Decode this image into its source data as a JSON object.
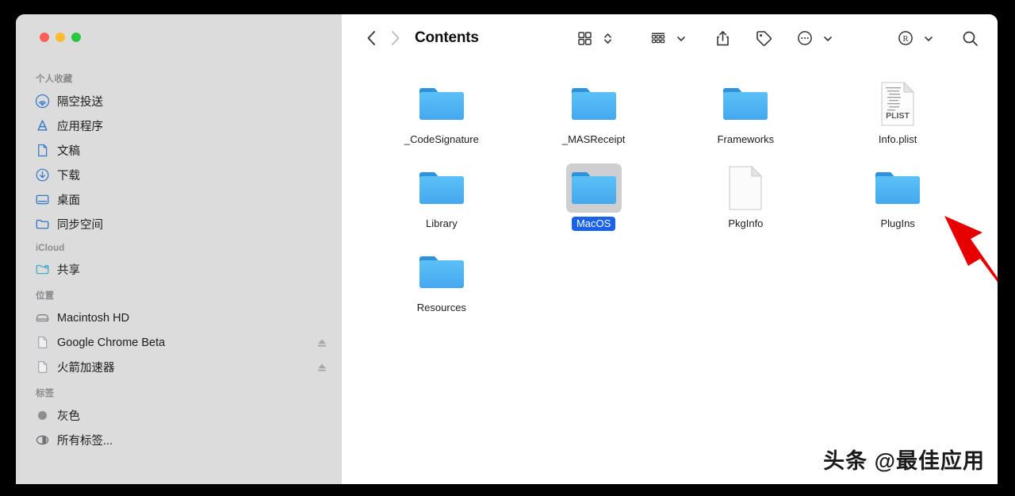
{
  "window": {
    "traffic_lights": [
      {
        "name": "close",
        "color": "#ff5f57"
      },
      {
        "name": "minimize",
        "color": "#febc2e"
      },
      {
        "name": "zoom",
        "color": "#28c840"
      }
    ]
  },
  "toolbar": {
    "back_icon": "chevron-left-icon",
    "forward_icon": "chevron-right-icon",
    "title": "Contents",
    "view_icon": "grid-view-icon",
    "view_chevron_icon": "chevron-up-down-icon",
    "group_icon": "group-by-icon",
    "group_chevron_icon": "chevron-down-icon",
    "share_icon": "share-icon",
    "tag_icon": "tag-icon",
    "more_icon": "ellipsis-circle-icon",
    "more_chevron_icon": "chevron-down-icon",
    "registered_icon": "registered-circle-icon",
    "registered_chevron_icon": "chevron-down-icon",
    "search_icon": "search-icon"
  },
  "sidebar": {
    "sections": [
      {
        "header": "个人收藏",
        "items": [
          {
            "label": "隔空投送",
            "icon": "airdrop-icon",
            "eject": false
          },
          {
            "label": "应用程序",
            "icon": "applications-icon",
            "eject": false
          },
          {
            "label": "文稿",
            "icon": "document-icon",
            "eject": false
          },
          {
            "label": "下载",
            "icon": "downloads-icon",
            "eject": false
          },
          {
            "label": "桌面",
            "icon": "desktop-icon",
            "eject": false
          },
          {
            "label": "同步空间",
            "icon": "folder-icon",
            "eject": false
          }
        ]
      },
      {
        "header": "iCloud",
        "items": [
          {
            "label": "共享",
            "icon": "shared-folder-icon",
            "eject": false
          }
        ]
      },
      {
        "header": "位置",
        "items": [
          {
            "label": "Macintosh HD",
            "icon": "hard-disk-icon",
            "eject": false
          },
          {
            "label": "Google Chrome Beta",
            "icon": "disk-image-icon",
            "eject": true
          },
          {
            "label": "火箭加速器",
            "icon": "disk-image-icon",
            "eject": true
          }
        ]
      },
      {
        "header": "标签",
        "items": [
          {
            "label": "灰色",
            "icon": "gray-tag-dot-icon",
            "eject": false
          },
          {
            "label": "所有标签...",
            "icon": "all-tags-icon",
            "eject": false
          }
        ]
      }
    ]
  },
  "files": [
    {
      "name": "_CodeSignature",
      "type": "folder",
      "selected": false
    },
    {
      "name": "_MASReceipt",
      "type": "folder",
      "selected": false
    },
    {
      "name": "Frameworks",
      "type": "folder",
      "selected": false
    },
    {
      "name": "Info.plist",
      "type": "plist",
      "selected": false
    },
    {
      "name": "Library",
      "type": "folder",
      "selected": false
    },
    {
      "name": "MacOS",
      "type": "folder",
      "selected": true
    },
    {
      "name": "PkgInfo",
      "type": "document",
      "selected": false
    },
    {
      "name": "PlugIns",
      "type": "folder",
      "selected": false
    },
    {
      "name": "Resources",
      "type": "folder",
      "selected": false
    }
  ],
  "annotation": {
    "arrow_color": "#e60000",
    "arrow_name": "red-pointer-arrow"
  },
  "watermark": {
    "text": "头条 @最佳应用"
  },
  "colors": {
    "sidebar_bg": "#dcdcdc",
    "content_bg": "#ffffff",
    "selection_blue": "#1a63e8",
    "folder_blue": "#4eb3f5",
    "desktop_bg": "#000000"
  }
}
